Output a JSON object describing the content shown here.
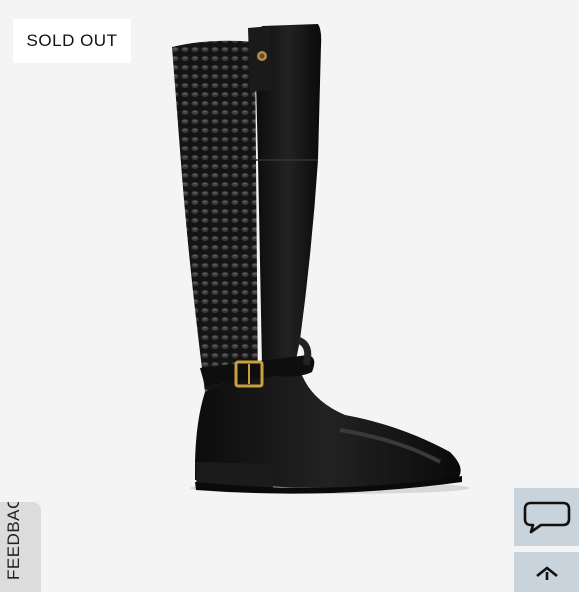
{
  "badge": {
    "label": "SOLD OUT"
  },
  "feedback": {
    "label": "FEEDBACK"
  },
  "product": {
    "image_alt": "Black knee-high riding boot with woven quilted panel and gold buckle strap"
  },
  "icons": {
    "chat": "chat-bubble-icon",
    "scroll_up": "arrow-up-icon"
  },
  "colors": {
    "background": "#f4f4f4",
    "boot": "#141414",
    "buckle": "#c8a040",
    "side_buttons": "#c9d3db"
  }
}
